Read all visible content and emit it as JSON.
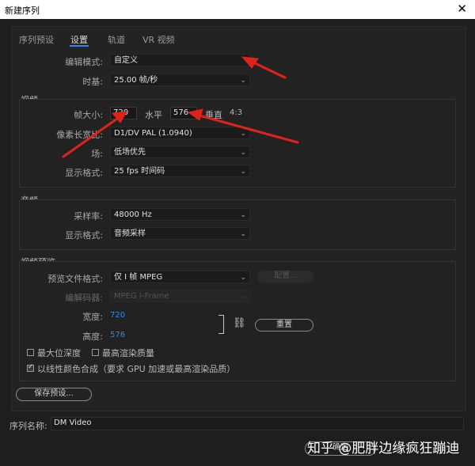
{
  "window": {
    "title": "新建序列",
    "close_glyph": "✕"
  },
  "tabs": [
    {
      "label": "序列预设"
    },
    {
      "label": "设置"
    },
    {
      "label": "轨道"
    },
    {
      "label": "VR 视频"
    }
  ],
  "editing": {
    "mode_label": "编辑模式:",
    "mode_value": "自定义",
    "timebase_label": "时基:",
    "timebase_value": "25.00  帧/秒"
  },
  "video": {
    "section_label": "视频",
    "frame_size_label": "帧大小:",
    "frame_width": "720",
    "horizontal_label": "水平",
    "frame_height": "576",
    "vertical_label": "垂直",
    "aspect": "4:3",
    "pixel_aspect_label": "像素长宽比:",
    "pixel_aspect_value": "D1/DV PAL (1.0940)",
    "fields_label": "场:",
    "fields_value": "低场优先",
    "display_format_label": "显示格式:",
    "display_format_value": "25 fps 时间码"
  },
  "audio": {
    "section_label": "音频",
    "sample_rate_label": "采样率:",
    "sample_rate_value": "48000 Hz",
    "display_format_label": "显示格式:",
    "display_format_value": "音频采样"
  },
  "preview": {
    "section_label": "视频预览",
    "file_format_label": "预览文件格式:",
    "file_format_value": "仅 I 帧 MPEG",
    "configure_label": "配置...",
    "codec_label": "编解码器:",
    "codec_value": "MPEG I-Frame",
    "width_label": "宽度:",
    "width_value": "720",
    "height_label": "高度:",
    "height_value": "576",
    "reset_label": "重置",
    "max_bit_depth_label": "最大位深度",
    "max_render_quality_label": "最高渲染质量",
    "linear_color_label": "以线性颜色合成（要求 GPU 加速或最高渲染品质）"
  },
  "save_preset_label": "保存预设...",
  "sequence_name_label": "序列名称:",
  "sequence_name_value": "DM Video",
  "ok_label": "确定",
  "watermark": "知乎 @肥胖边缘疯狂蹦迪",
  "colors": {
    "accent": "#2d8ceb",
    "arrow": "#e0231a",
    "background": "#1e1e1e"
  }
}
